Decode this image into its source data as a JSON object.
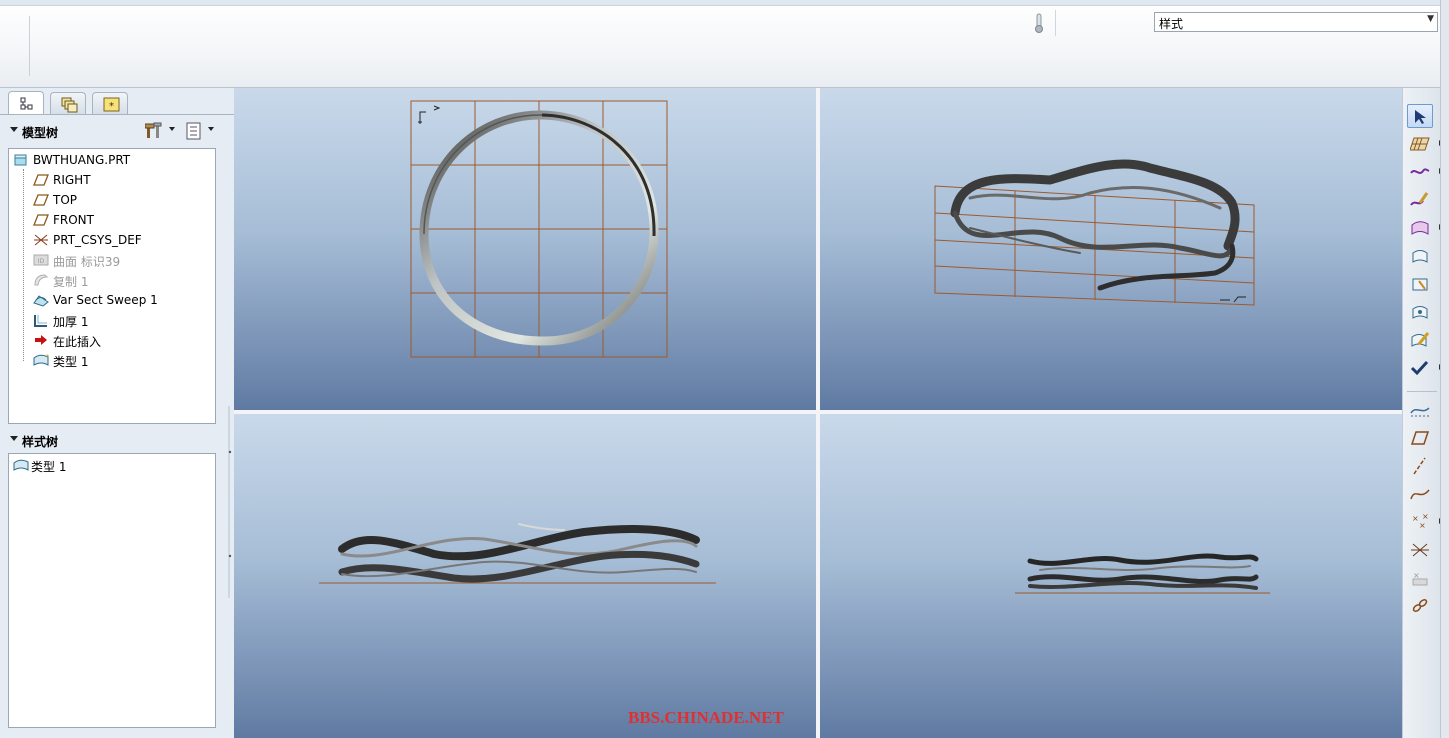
{
  "ribbon": {
    "style_select_value": "样式"
  },
  "model_tree": {
    "title": "模型树",
    "items": [
      {
        "label": "BWTHUANG.PRT",
        "icon": "part-icon",
        "dim": false
      },
      {
        "label": "RIGHT",
        "icon": "datum-plane-icon",
        "dim": false
      },
      {
        "label": "TOP",
        "icon": "datum-plane-icon",
        "dim": false
      },
      {
        "label": "FRONT",
        "icon": "datum-plane-icon",
        "dim": false
      },
      {
        "label": "PRT_CSYS_DEF",
        "icon": "csys-icon",
        "dim": false
      },
      {
        "label": "曲面 标识39",
        "icon": "surface-icon",
        "dim": true
      },
      {
        "label": "复制 1",
        "icon": "copy-icon",
        "dim": true
      },
      {
        "label": "Var Sect Sweep 1",
        "icon": "sweep-icon",
        "dim": false
      },
      {
        "label": "加厚 1",
        "icon": "thicken-icon",
        "dim": false
      },
      {
        "label": "在此插入",
        "icon": "insert-here-arrow-icon",
        "dim": false
      },
      {
        "label": "类型 1",
        "icon": "style-feature-icon",
        "dim": false
      }
    ]
  },
  "style_tree": {
    "title": "样式树",
    "items": [
      {
        "label": "类型 1",
        "icon": "style-feature-icon"
      }
    ]
  },
  "watermark": "BBS.CHINADE.NET",
  "colors": {
    "grid": "#9c5a2e",
    "viewport_top": "#c9d9ea",
    "viewport_bottom": "#5f7aa2",
    "watermark": "#e03030"
  }
}
